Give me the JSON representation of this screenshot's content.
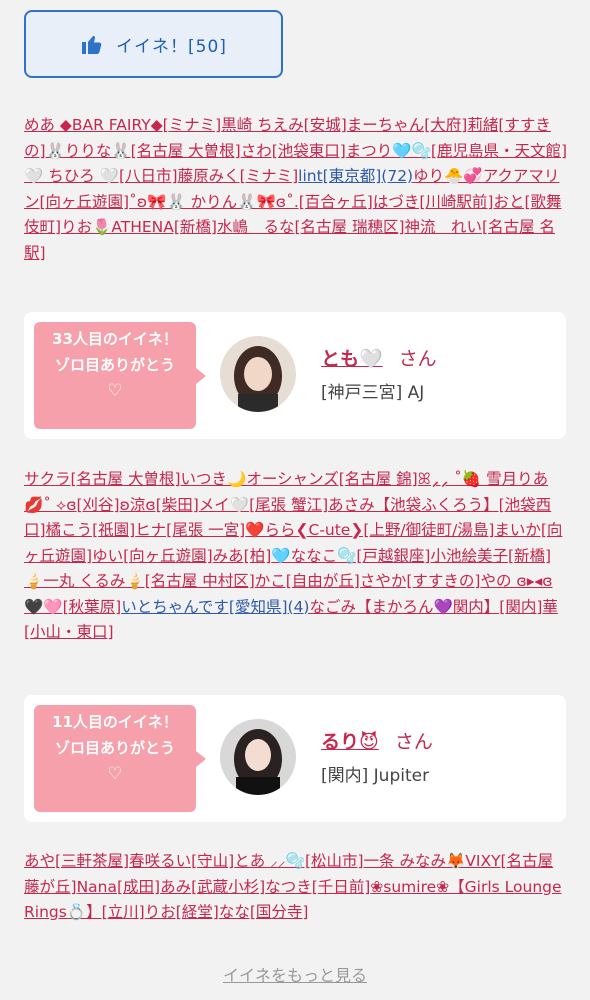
{
  "like_button": {
    "label": "イイネ！[50]"
  },
  "list1": [
    "めあ ◆BAR FAIRY◆[ミナミ]",
    "黒崎 ちえみ[安城]",
    "まーちゃん[大府]",
    "莉緒[すすきの]",
    "🐰りりな🐰[名古屋 大曽根]",
    "さわ[池袋東口]",
    "まつり🩵🫧[鹿児島県・天文館]",
    "🤍 ちひろ 🤍[八日市]",
    "藤原みく[ミナミ]",
    "lint[東京都](72)",
    "ゆり🐣💞アクアマリン[向ヶ丘遊園]",
    "˚ʚ🎀🐰 かりん🐰🎀ɞ˚.[百合ヶ丘]",
    "はづき[川崎駅前]",
    "おと[歌舞伎町]",
    "りお🌷ATHENA[新橋]",
    "水嶋　るな[名古屋 瑞穂区]",
    "神流　れい[名古屋 名駅]"
  ],
  "card1": {
    "bubble_line1": "33人目のイイネ！",
    "bubble_line2": "ゾロ目ありがとう",
    "heart": "♡",
    "name": "とも🤍",
    "san": "さん",
    "shop": "[神戸三宮] AJ"
  },
  "list2": [
    "サクラ[名古屋 大曽根]",
    "いつき🌙オーシャンズ[名古屋 錦]",
    "ꕤ⸝⸝ ˚🍓 雪月りあ 💋˚ ⟡ɞ[刈谷]",
    "ʚ涼ɞ[柴田]",
    "メイ🤍[尾張 蟹江]",
    "あさみ【池袋ふくろう】[池袋西口]",
    "橘こう[祇園]",
    "ヒナ[尾張 一宮]",
    "❤️らら❮C-ute❯[上野/御徒町/湯島]",
    "まいか[向ヶ丘遊園]",
    "ゆい[向ヶ丘遊園]",
    "みあ[柏]",
    "🩵ななこ🫧[戸越銀座]",
    "小池絵美子[新橋]",
    "🍦一丸 くるみ🍦[名古屋 中村区]",
    "かこ[自由が丘]",
    "さやか[すすきの]",
    "やの ɞ▸◂ɞ🖤🩷[秋葉原]",
    "いとちゃんです[愛知県](4)",
    "なごみ【まかろん💜関内】[関内]",
    "華[小山・東口]"
  ],
  "card2": {
    "bubble_line1": "11人目のイイネ！",
    "bubble_line2": "ゾロ目ありがとう",
    "heart": "♡",
    "name": "るり😈",
    "san": "さん",
    "shop": "[関内] Jupiter"
  },
  "list3": [
    "あや[三軒茶屋]",
    "春咲るい[守山]",
    "とあ ⸝⸝🫧[松山市]",
    "一条 みなみ🦊VIXY[名古屋 藤が丘]",
    "Nana[成田]",
    "あみ[武蔵小杉]",
    "なつき[千日前]",
    "❀sumire❀【Girls Lounge Rings💍】[立川]",
    "りお[経堂]",
    "なな[国分寺]"
  ],
  "more_link": "イイネをもっと見る",
  "colors": {
    "accent": "#c5284d",
    "button_border": "#2e73c8",
    "bubble": "#f5a0ab"
  }
}
